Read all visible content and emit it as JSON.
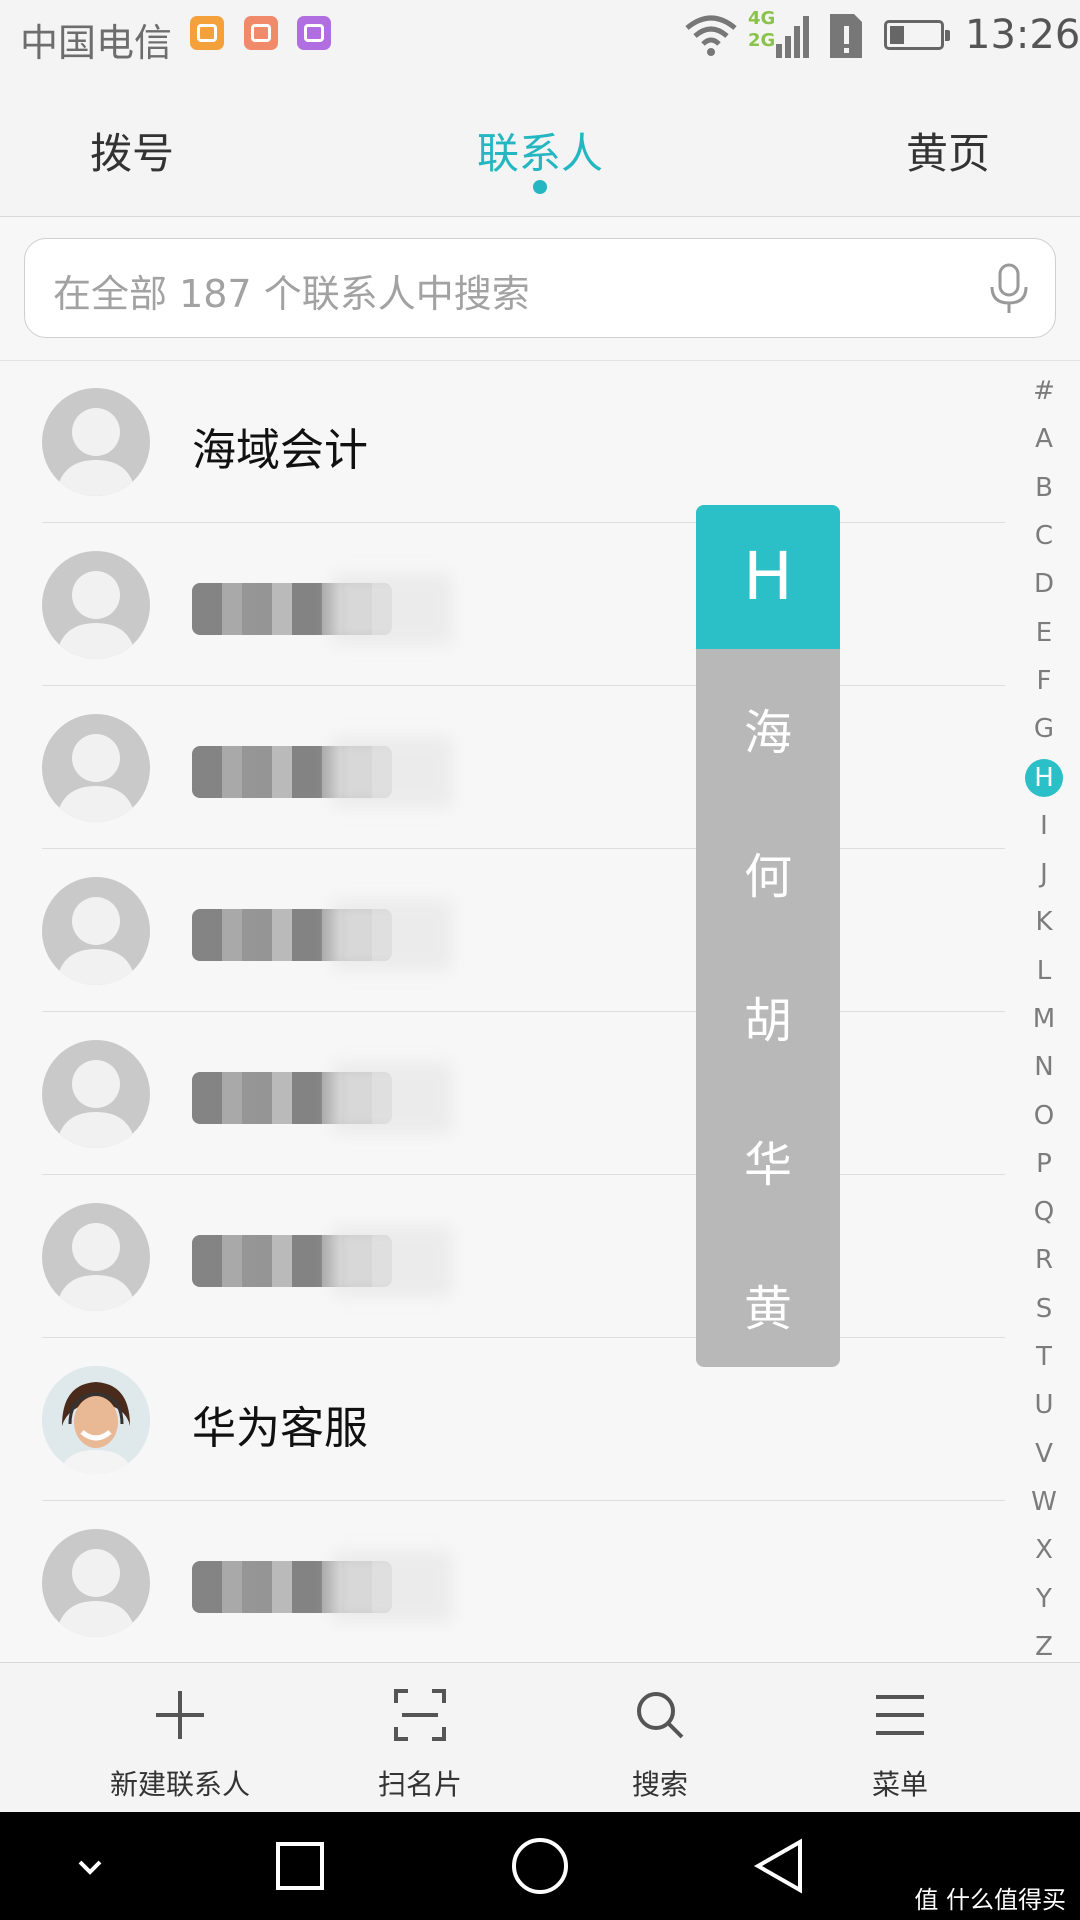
{
  "status_bar": {
    "carrier": "中国电信",
    "net_4g": "4G",
    "net_2g": "2G",
    "time": "13:26"
  },
  "tabs": [
    {
      "label": "拨号"
    },
    {
      "label": "联系人",
      "active": true
    },
    {
      "label": "黄页"
    }
  ],
  "search": {
    "placeholder": "在全部 187 个联系人中搜索"
  },
  "contacts": [
    {
      "name": "海域会计"
    },
    {
      "name": ""
    },
    {
      "name": ""
    },
    {
      "name": ""
    },
    {
      "name": ""
    },
    {
      "name": ""
    },
    {
      "name": "华为客服",
      "has_photo": true
    },
    {
      "name": ""
    }
  ],
  "index_popup": {
    "letter": "H",
    "chars": [
      "海",
      "何",
      "胡",
      "华",
      "黄"
    ]
  },
  "alphabet": [
    "#",
    "A",
    "B",
    "C",
    "D",
    "E",
    "F",
    "G",
    "H",
    "I",
    "J",
    "K",
    "L",
    "M",
    "N",
    "O",
    "P",
    "Q",
    "R",
    "S",
    "T",
    "U",
    "V",
    "W",
    "X",
    "Y",
    "Z"
  ],
  "alphabet_active": "H",
  "bottom_actions": [
    {
      "label": "新建联系人",
      "icon": "plus-icon"
    },
    {
      "label": "扫名片",
      "icon": "scan-icon"
    },
    {
      "label": "搜索",
      "icon": "search-icon"
    },
    {
      "label": "菜单",
      "icon": "menu-icon"
    }
  ],
  "watermark": "值 什么值得买",
  "colors": {
    "accent": "#2bbfc7",
    "background": "#f7f7f7"
  }
}
